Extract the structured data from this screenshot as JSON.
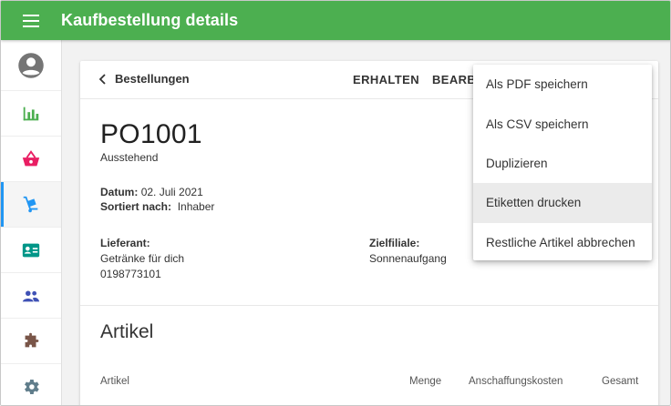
{
  "appbar": {
    "title": "Kaufbestellung details",
    "menu_icon": "hamburger-menu-icon"
  },
  "sidebar": {
    "items": [
      {
        "icon": "account-circle-icon",
        "color": "#757575"
      },
      {
        "icon": "bar-chart-icon",
        "color": "#4caf50"
      },
      {
        "icon": "shopping-basket-icon",
        "color": "#e91e63"
      },
      {
        "icon": "hand-truck-icon",
        "color": "#2196f3",
        "active": true
      },
      {
        "icon": "contact-card-icon",
        "color": "#009688"
      },
      {
        "icon": "people-icon",
        "color": "#3f51b5"
      },
      {
        "icon": "puzzle-icon",
        "color": "#795548"
      },
      {
        "icon": "gear-icon",
        "color": "#607d8b"
      }
    ],
    "active_color": "#2196f3"
  },
  "toolbar": {
    "back_label": "Bestellungen",
    "receive_label": "ERHALTEN",
    "edit_label": "BEARBEITEN"
  },
  "order": {
    "number": "PO1001",
    "status": "Ausstehend",
    "date_label": "Datum:",
    "date_value": "02. Juli 2021",
    "sort_label": "Sortiert nach:",
    "sort_value": "Inhaber",
    "supplier_label": "Lieferant:",
    "supplier_name": "Getränke für dich",
    "supplier_phone": "0198773101",
    "branch_label": "Zielfiliale:",
    "branch_name": "Sonnenaufgang"
  },
  "articles": {
    "title": "Artikel",
    "columns": [
      "Artikel",
      "Menge",
      "Anschaffungskosten",
      "Gesamt"
    ]
  },
  "menu": {
    "items": [
      {
        "label": "Als PDF speichern"
      },
      {
        "label": "Als CSV speichern"
      },
      {
        "label": "Duplizieren"
      },
      {
        "label": "Etiketten drucken",
        "hovered": true
      },
      {
        "label": "Restliche Artikel abbrechen"
      }
    ]
  },
  "colors": {
    "appbar": "#4caf50",
    "menu_hover": "#ebebeb"
  }
}
